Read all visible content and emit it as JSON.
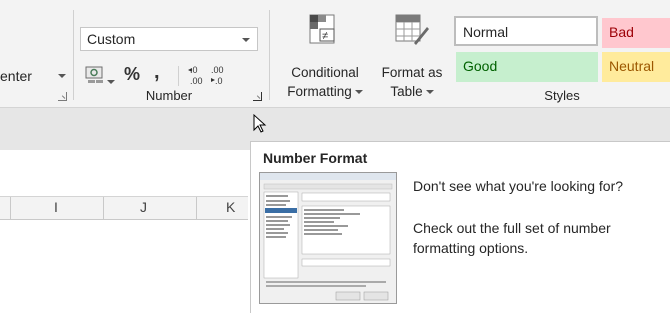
{
  "ribbon": {
    "alignment_fragment": "enter",
    "number_group": {
      "format_value": "Custom",
      "percent_symbol": "%",
      "comma_symbol": ",",
      "increase_decimal_label": "←.0 .00",
      "decrease_decimal_label": ".00 →.0",
      "label": "Number"
    },
    "conditional_formatting": {
      "label_line1": "Conditional",
      "label_line2": "Formatting"
    },
    "format_as_table": {
      "label_line1": "Format as",
      "label_line2": "Table"
    },
    "styles": {
      "label": "Styles",
      "cells": [
        {
          "name": "Normal",
          "bg": "#ffffff",
          "fg": "#262626"
        },
        {
          "name": "Bad",
          "bg": "#ffc7ce",
          "fg": "#9c0006"
        },
        {
          "name": "Good",
          "bg": "#c6efce",
          "fg": "#006100"
        },
        {
          "name": "Neutral",
          "bg": "#ffeb9c",
          "fg": "#9c5700"
        }
      ]
    }
  },
  "sheet": {
    "columns": [
      "I",
      "J",
      "K"
    ]
  },
  "tooltip": {
    "title": "Number Format",
    "line1": "Don't see what you're looking for?",
    "line2": "Check out the full set of number formatting options."
  }
}
